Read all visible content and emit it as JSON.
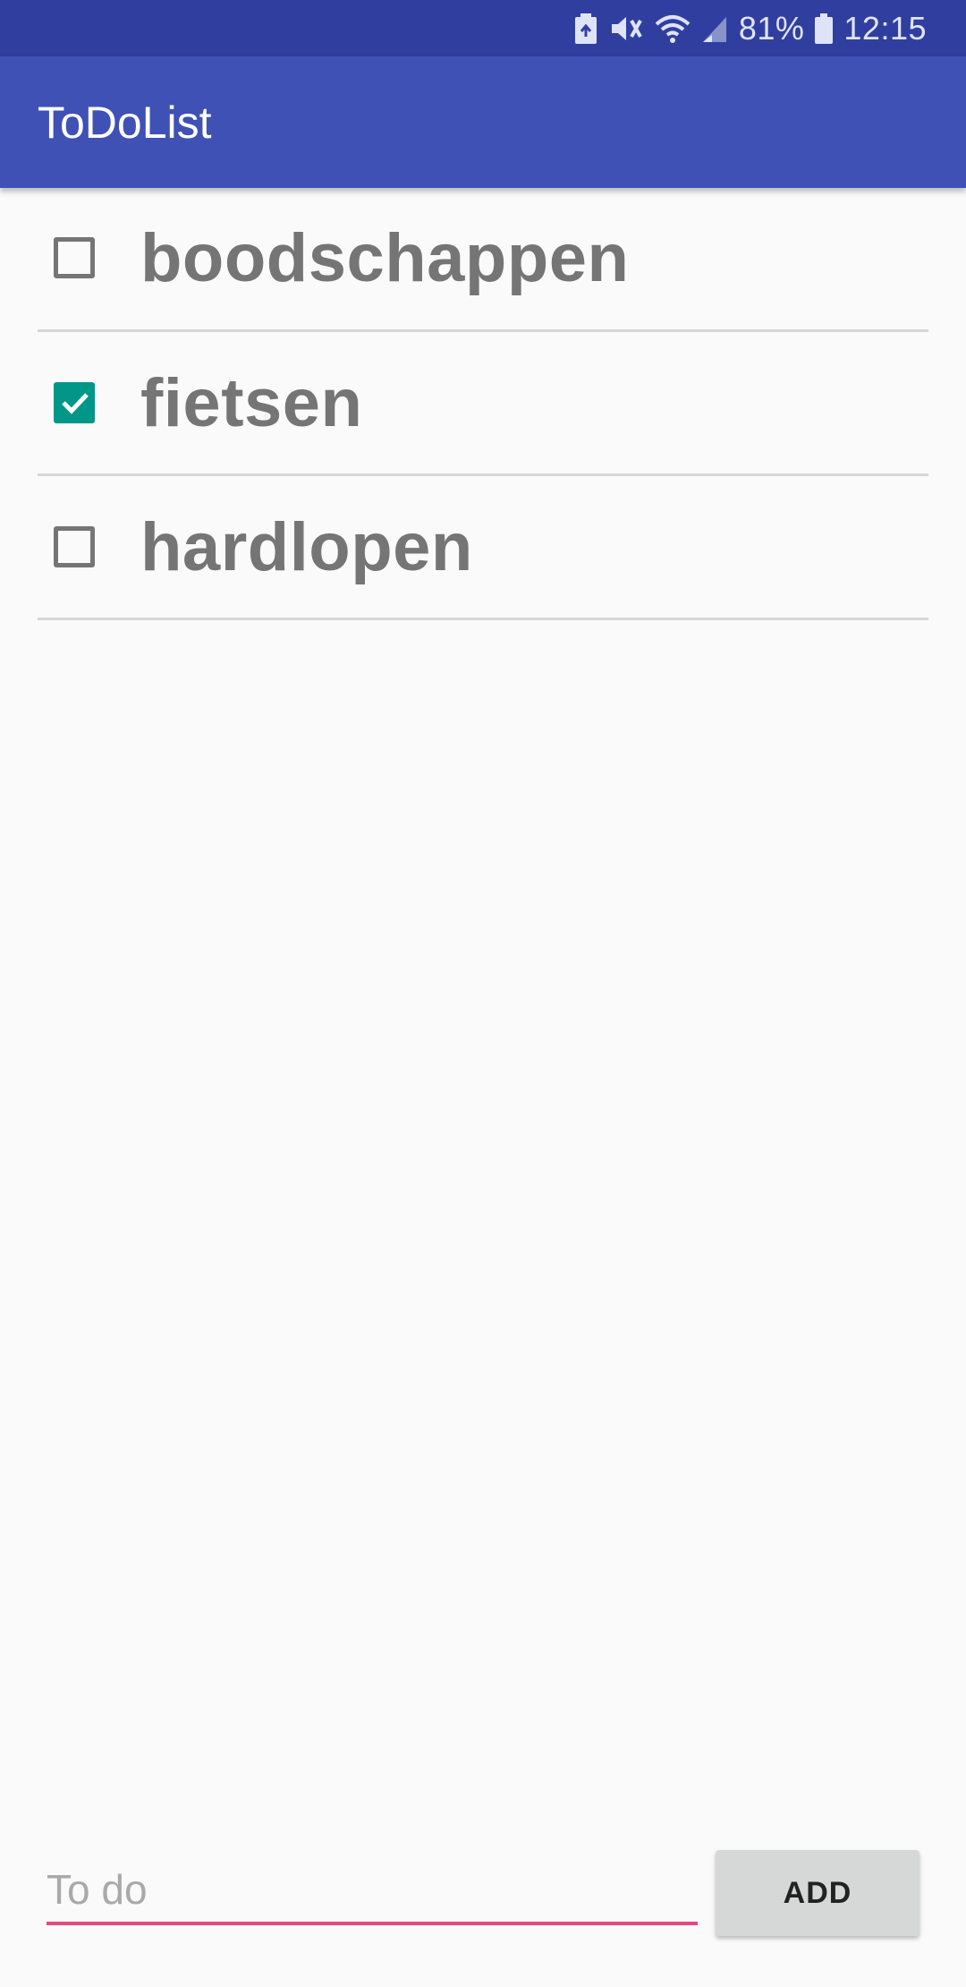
{
  "status_bar": {
    "battery_percent": "81%",
    "time": "12:15",
    "icons": [
      "battery-saver-icon",
      "mute-vibrate-icon",
      "wifi-icon",
      "cellular-signal-icon",
      "battery-icon"
    ]
  },
  "app_bar": {
    "title": "ToDoList"
  },
  "todos": [
    {
      "label": "boodschappen",
      "checked": false
    },
    {
      "label": "fietsen",
      "checked": true
    },
    {
      "label": "hardlopen",
      "checked": false
    }
  ],
  "input": {
    "value": "",
    "placeholder": "To do"
  },
  "add_button": {
    "label": "ADD"
  },
  "colors": {
    "status_bar": "#303f9f",
    "app_bar": "#3f51b5",
    "checkbox_checked": "#009688",
    "input_underline": "#e8477f",
    "text_gray": "#757575"
  }
}
